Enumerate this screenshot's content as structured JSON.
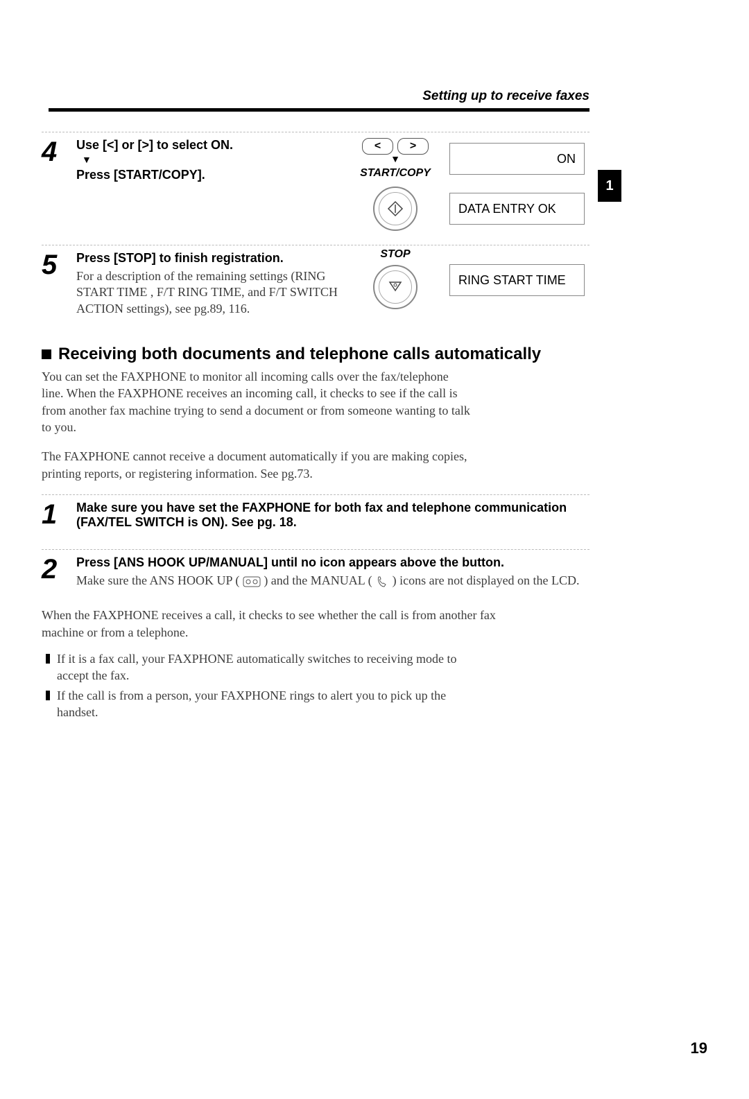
{
  "header": {
    "title": "Setting up to receive faxes"
  },
  "tab": {
    "number": "1"
  },
  "steps_a": [
    {
      "num": "4",
      "line1": "Use [<] or [>] to select ON.",
      "line2": "Press [START/COPY].",
      "btn_left": "<",
      "btn_right": ">",
      "label1": "START/COPY",
      "lcd1": "ON",
      "lcd2": "DATA ENTRY OK"
    },
    {
      "num": "5",
      "line1": "Press [STOP] to finish registration.",
      "desc": "For a description of the remaining settings (RING START TIME , F/T RING TIME, and F/T SWITCH ACTION settings), see pg.89, 116.",
      "label1": "STOP",
      "lcd1": "RING START TIME"
    }
  ],
  "section": {
    "heading": "Receiving both documents and telephone calls automatically",
    "para1": "You can set the FAXPHONE to monitor all incoming calls over the fax/telephone line. When the FAXPHONE receives an incoming call, it checks to see if the call is from another fax machine trying to send a document or from someone wanting to talk to you.",
    "para2": "The FAXPHONE cannot receive a document automatically if you are making copies, printing reports, or registering information. See pg.73."
  },
  "steps_b": [
    {
      "num": "1",
      "line1": "Make sure you have set the FAXPHONE for both fax and telephone communication (FAX/TEL SWITCH is ON). See pg. 18."
    },
    {
      "num": "2",
      "line1": "Press [ANS HOOK UP/MANUAL] until no icon appears above the button.",
      "desc_a": "Make sure the ANS HOOK UP (",
      "desc_b": ") and the MANUAL (",
      "desc_c": ") icons are not displayed on the LCD."
    }
  ],
  "closing": {
    "para": "When the FAXPHONE receives a call, it checks to see whether the call is from another fax machine or from a telephone.",
    "bullets": [
      "If it is a fax call, your FAXPHONE automatically switches to receiving mode to accept the fax.",
      "If the call is from a person, your FAXPHONE rings to alert you to pick up the handset."
    ]
  },
  "page_number": "19"
}
